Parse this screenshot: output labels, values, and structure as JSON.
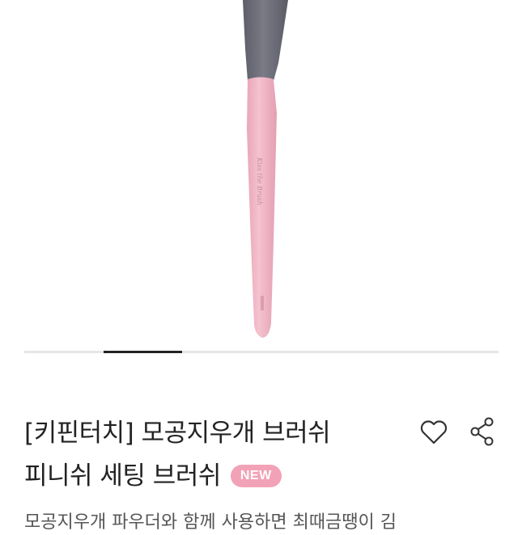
{
  "product": {
    "image_alt": "makeup brush with pink handle and grey ferrule",
    "handle_imprint": "Kiss the Brush",
    "title_line1": "[키핀터치] 모공지우개 브러쉬",
    "title_line2": "피니쉬 세팅 브러쉬",
    "badge": "NEW",
    "description": "모공지우개 파우더와 함께 사용하면 최때금땡이 김"
  },
  "carousel": {
    "total": 6,
    "current": 2
  },
  "icons": {
    "like": "heart-outline-icon",
    "share": "share-icon"
  },
  "colors": {
    "badge_bg": "#f2a2b6",
    "handle_pink": "#f2b6c6",
    "ferrule_grey": "#6d6e78",
    "text": "#222222"
  }
}
